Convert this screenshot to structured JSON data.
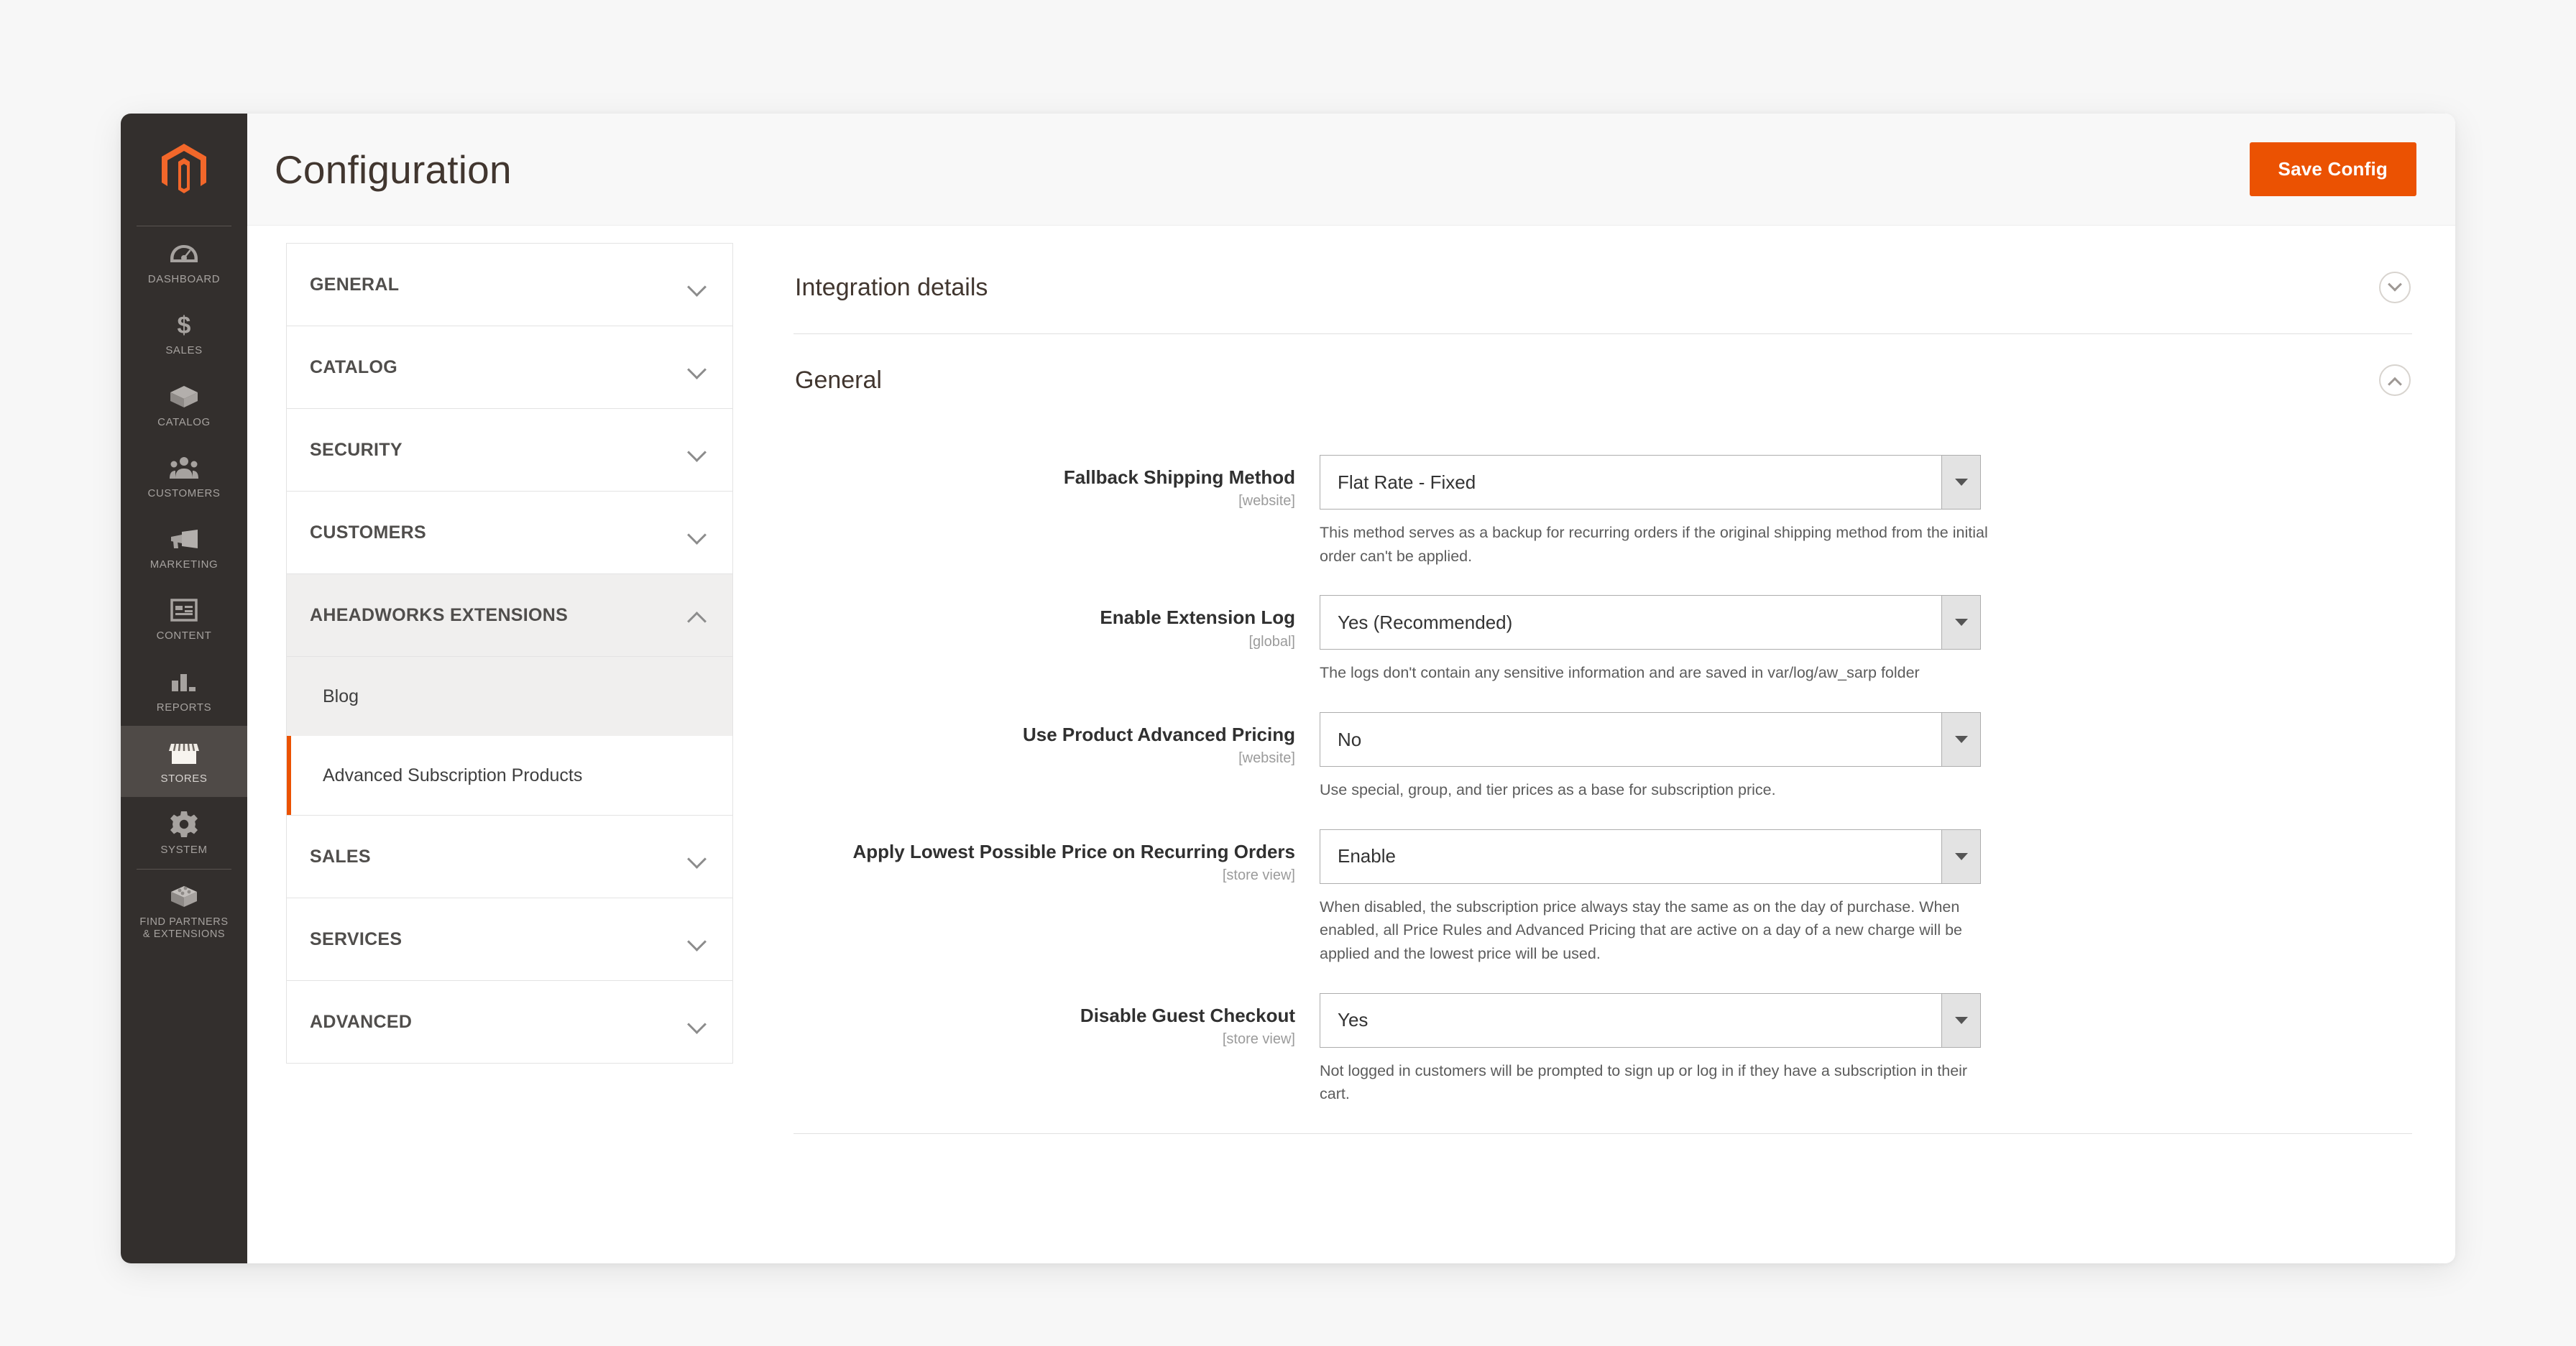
{
  "theme": {
    "accent": "#eb5202",
    "nav_bg": "#332f2d",
    "nav_active_bg": "#4f4a47",
    "header_bg": "#f8f8f8",
    "title_color": "#41362f"
  },
  "admin_nav": {
    "logo_name": "magento-logo",
    "items": [
      {
        "label": "DASHBOARD",
        "icon": "dashboard-gauge-icon",
        "active": false
      },
      {
        "label": "SALES",
        "icon": "dollar-sign-icon",
        "active": false
      },
      {
        "label": "CATALOG",
        "icon": "box-icon",
        "active": false
      },
      {
        "label": "CUSTOMERS",
        "icon": "people-icon",
        "active": false
      },
      {
        "label": "MARKETING",
        "icon": "megaphone-icon",
        "active": false
      },
      {
        "label": "CONTENT",
        "icon": "layout-window-icon",
        "active": false
      },
      {
        "label": "REPORTS",
        "icon": "bar-chart-icon",
        "active": false
      },
      {
        "label": "STORES",
        "icon": "storefront-icon",
        "active": true
      },
      {
        "label": "SYSTEM",
        "icon": "gear-icon",
        "active": false
      },
      {
        "label": "FIND PARTNERS\n& EXTENSIONS",
        "label_line1": "FIND PARTNERS",
        "label_line2": "& EXTENSIONS",
        "icon": "extension-block-icon",
        "active": false
      }
    ]
  },
  "header": {
    "title": "Configuration",
    "save_label": "Save Config"
  },
  "config_nav": {
    "groups": [
      {
        "label": "GENERAL",
        "expanded": false,
        "children": []
      },
      {
        "label": "CATALOG",
        "expanded": false,
        "children": []
      },
      {
        "label": "SECURITY",
        "expanded": false,
        "children": []
      },
      {
        "label": "CUSTOMERS",
        "expanded": false,
        "children": []
      },
      {
        "label": "AHEADWORKS EXTENSIONS",
        "expanded": true,
        "children": [
          {
            "label": "Blog",
            "selected": false
          },
          {
            "label": "Advanced Subscription Products",
            "selected": true
          }
        ]
      },
      {
        "label": "SALES",
        "expanded": false,
        "children": []
      },
      {
        "label": "SERVICES",
        "expanded": false,
        "children": []
      },
      {
        "label": "ADVANCED",
        "expanded": false,
        "children": []
      }
    ]
  },
  "settings": {
    "sections": [
      {
        "title": "Integration details",
        "expanded": false
      },
      {
        "title": "General",
        "expanded": true
      }
    ],
    "fields": [
      {
        "label": "Fallback Shipping Method",
        "scope": "[website]",
        "value": "Flat Rate - Fixed",
        "note": "This method serves as a backup for recurring orders if the original shipping method from the initial order can't be applied."
      },
      {
        "label": "Enable Extension Log",
        "scope": "[global]",
        "value": "Yes (Recommended)",
        "note": "The logs don't contain any sensitive information and are saved in var/log/aw_sarp folder"
      },
      {
        "label": "Use Product Advanced Pricing",
        "scope": "[website]",
        "value": "No",
        "note": "Use special, group, and tier prices as a base for subscription price."
      },
      {
        "label": "Apply Lowest Possible Price on Recurring Orders",
        "scope": "[store view]",
        "value": "Enable",
        "note": "When disabled, the subscription price always stay the same as on the day of purchase. When enabled, all Price Rules and Advanced Pricing that are active on a day of a new charge will be applied and the lowest price will be used."
      },
      {
        "label": "Disable Guest Checkout",
        "scope": "[store view]",
        "value": "Yes",
        "note": "Not logged in customers will be prompted to sign up or log in if they have a subscription in their cart."
      }
    ]
  }
}
